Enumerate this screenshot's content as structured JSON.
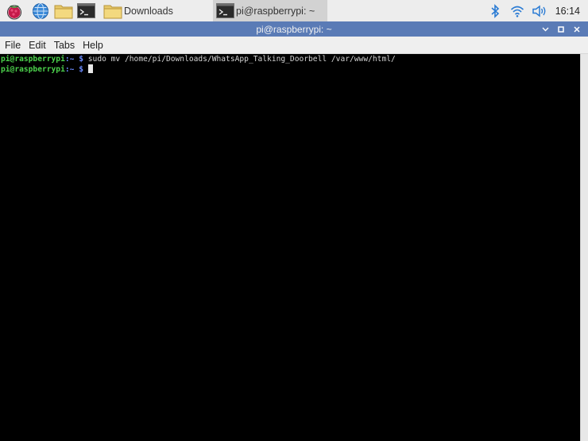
{
  "taskbar": {
    "icons": [
      {
        "name": "raspberry-menu-icon"
      },
      {
        "name": "web-browser-icon"
      },
      {
        "name": "file-manager-icon"
      },
      {
        "name": "terminal-icon"
      }
    ],
    "windows": [
      {
        "label": "Downloads",
        "icon": "folder-icon",
        "active": false
      },
      {
        "label": "pi@raspberrypi: ~",
        "icon": "terminal-icon",
        "active": true
      }
    ],
    "tray": {
      "clock": "16:14",
      "icons": [
        "bluetooth-icon",
        "wifi-icon",
        "volume-icon"
      ]
    },
    "colors": {
      "bluetooth": "#2a7bd4",
      "wifi": "#2a7bd4",
      "volume": "#2a7bd4"
    }
  },
  "window": {
    "title": "pi@raspberrypi: ~",
    "titlebar_color": "#5a7bb6"
  },
  "menu": {
    "items": [
      "File",
      "Edit",
      "Tabs",
      "Help"
    ]
  },
  "terminal": {
    "lines": [
      {
        "user": "pi@raspberrypi",
        "path": "~",
        "symbol": "$",
        "command": "sudo mv /home/pi/Downloads/WhatsApp_Talking_Doorbell /var/www/html/"
      },
      {
        "user": "pi@raspberrypi",
        "path": "~",
        "symbol": "$",
        "command": ""
      }
    ],
    "colors": {
      "user": "#4cd24c",
      "path": "#6b8bff",
      "background": "#000000"
    }
  }
}
